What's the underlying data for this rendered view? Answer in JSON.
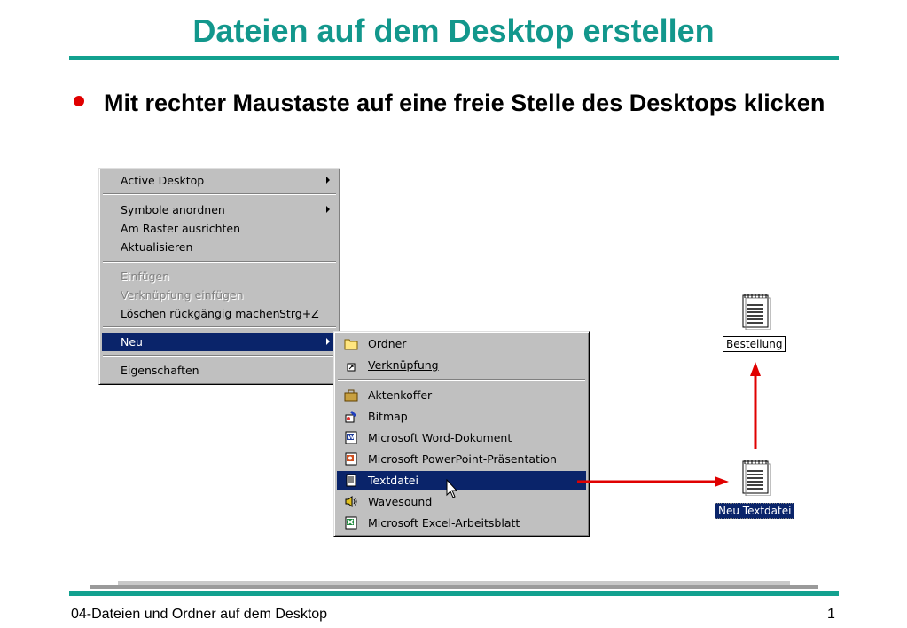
{
  "slide": {
    "title": "Dateien auf dem Desktop erstellen",
    "bullet": "Mit rechter Maustaste auf eine freie Stelle des Desktops klicken",
    "footer": "04-Dateien und Ordner auf dem Desktop",
    "page_number": "1"
  },
  "context_menu": {
    "active_desktop": "Active Desktop",
    "arrange_icons": "Symbole anordnen",
    "align_grid": "Am Raster ausrichten",
    "refresh": "Aktualisieren",
    "paste": "Einfügen",
    "paste_shortcut": "Verknüpfung einfügen",
    "undo_delete": "Löschen rückgängig machen",
    "undo_shortcut": "Strg+Z",
    "new": "Neu",
    "properties": "Eigenschaften"
  },
  "submenu": {
    "folder": "Ordner",
    "shortcut": "Verknüpfung",
    "briefcase": "Aktenkoffer",
    "bitmap": "Bitmap",
    "word": "Microsoft Word-Dokument",
    "powerpoint": "Microsoft PowerPoint-Präsentation",
    "textfile": "Textdatei",
    "wavesound": "Wavesound",
    "excel": "Microsoft Excel-Arbeitsblatt"
  },
  "desktop": {
    "new_file_label": "Neu Textdatei",
    "renamed_label": "Bestellung"
  },
  "colors": {
    "title": "#12978c",
    "accent_rule": "#12a18f",
    "bullet": "#e00000",
    "menu_highlight": "#0a246a",
    "arrow": "#e00000"
  },
  "icons": [
    "folder-icon",
    "shortcut-icon",
    "briefcase-icon",
    "bitmap-icon",
    "word-icon",
    "powerpoint-icon",
    "textfile-icon",
    "wavesound-icon",
    "excel-icon",
    "notepad-icon",
    "mouse-cursor-icon"
  ]
}
